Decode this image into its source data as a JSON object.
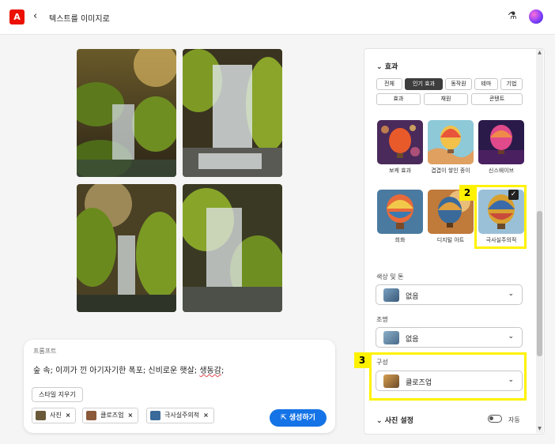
{
  "header": {
    "logo_text": "A",
    "back_icon": "chevron-left-icon",
    "title": "텍스트를 이미지로",
    "lab_icon": "flask-icon",
    "avatar_icon": "avatar-icon"
  },
  "prompt": {
    "label": "프롬프트",
    "text_before": "숲 속; 이끼가 낀 아기자기한 폭포; 신비로운 햇살; ",
    "text_underlined": "생동감",
    "text_after": ";",
    "clear_style_label": "스타일 지우기",
    "chips": [
      {
        "label": "사진",
        "remove": "×",
        "thumb_color": "#6b5a3a"
      },
      {
        "label": "클로즈업",
        "remove": "×",
        "thumb_color": "#8a5a3a"
      },
      {
        "label": "극사실주의적",
        "remove": "×",
        "thumb_color": "#3a6a9a"
      }
    ],
    "generate_label": "생성하기",
    "generate_icon": "export-icon"
  },
  "panel": {
    "effects_title": "효과",
    "tabs_row1": [
      {
        "label": "전체",
        "active": false
      },
      {
        "label": "인기 효과",
        "active": true
      },
      {
        "label": "동작원",
        "active": false
      },
      {
        "label": "테마",
        "active": false
      },
      {
        "label": "기법",
        "active": false
      }
    ],
    "tabs_row2": [
      {
        "label": "효과"
      },
      {
        "label": "재원"
      },
      {
        "label": "콘텐트"
      }
    ],
    "styles": [
      {
        "label": "보케 효과",
        "selected": false
      },
      {
        "label": "겹겹이 쌓인 종이",
        "selected": false
      },
      {
        "label": "신스웨이브",
        "selected": false
      },
      {
        "label": "희화",
        "selected": false
      },
      {
        "label": "디지털 아트",
        "selected": false
      },
      {
        "label": "극사실주의적",
        "selected": true
      }
    ],
    "check_icon": "✓",
    "color_tone_label": "색상 및 톤",
    "color_tone_value": "없음",
    "lighting_label": "조명",
    "lighting_value": "없음",
    "composition_label": "구성",
    "composition_value": "클로즈업",
    "photo_settings_title": "사진 설정",
    "auto_label": "자동"
  },
  "annotations": {
    "badge_2": "2",
    "badge_3": "3",
    "highlight_color": "#fff200"
  },
  "colors": {
    "accent": "#1473e6",
    "brand_red": "#eb1000"
  }
}
